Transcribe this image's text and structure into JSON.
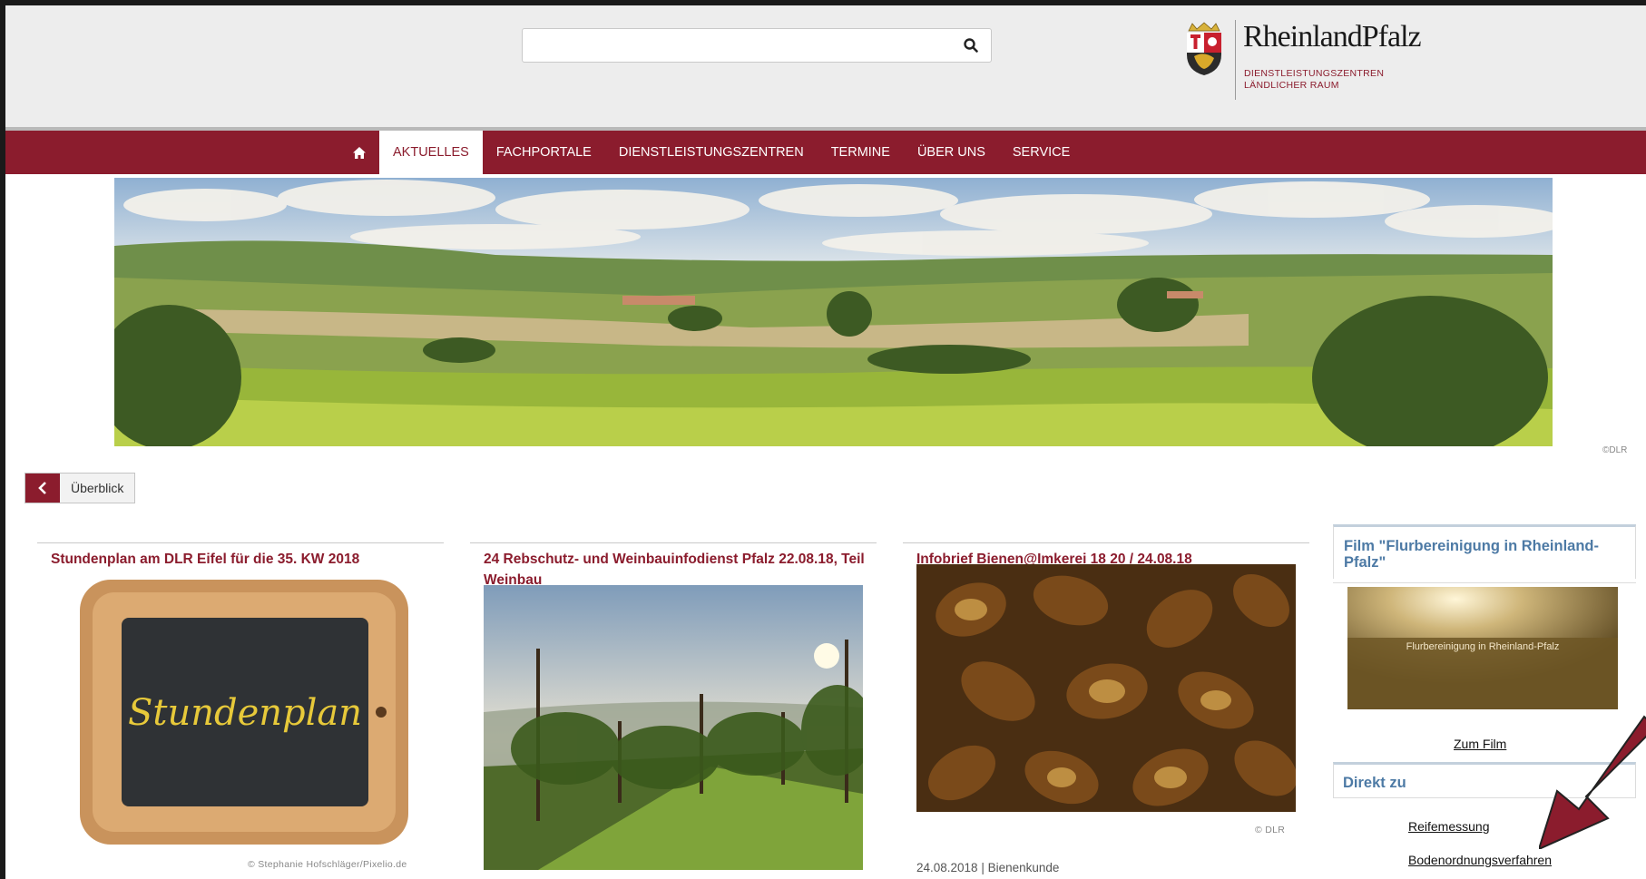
{
  "header": {
    "search_placeholder": "",
    "logo_title": "RheinlandPfalz",
    "logo_subtitle_line1": "DIENSTLEISTUNGSZENTREN",
    "logo_subtitle_line2": "LÄNDLICHER RAUM"
  },
  "nav": {
    "home_icon": "home-icon",
    "items": [
      "AKTUELLES",
      "FACHPORTALE",
      "DIENSTLEISTUNGSZENTREN",
      "TERMINE",
      "ÜBER UNS",
      "SERVICE"
    ],
    "active": "AKTUELLES"
  },
  "hero": {
    "credit": "©DLR"
  },
  "back": {
    "label": "Überblick",
    "icon": "chevron-left-icon"
  },
  "cards": [
    {
      "title": "Stundenplan am DLR Eifel für die 35. KW 2018",
      "image_text": "Stundenplan",
      "credit": "© Stephanie Hofschläger/Pixelio.de"
    },
    {
      "title": "24 Rebschutz- und Weinbauinfodienst Pfalz 22.08.18, Teil Weinbau"
    },
    {
      "title": "Infobrief Bienen@Imkerei 18 20 / 24.08.18",
      "credit": "© DLR",
      "meta": "24.08.2018 | Bienenkunde"
    }
  ],
  "sidebar": {
    "film_title": "Film \"Flurbereinigung in Rheinland-Pfalz\"",
    "video_label": "Flurbereinigung in Rheinland-Pfalz",
    "film_link": "Zum Film",
    "direkt_title": "Direkt zu",
    "direkt_links": [
      "Reifemessung",
      "Bodenordnungsverfahren"
    ]
  },
  "colors": {
    "brand": "#8b1c2d",
    "sidebar_title": "#4d7aa5",
    "header_bg": "#ededed"
  }
}
